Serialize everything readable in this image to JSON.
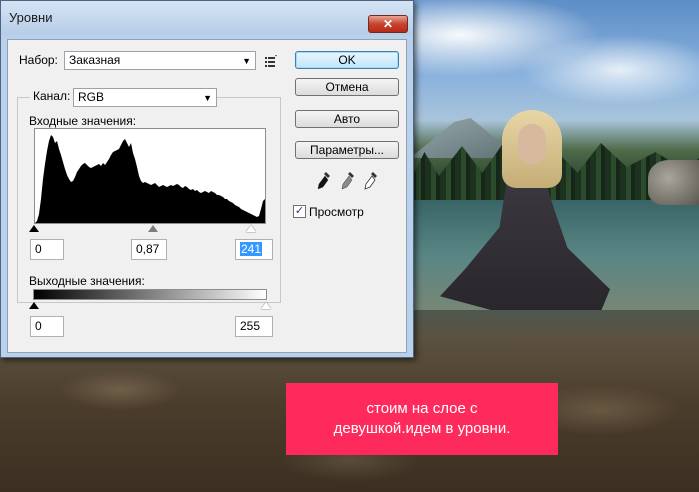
{
  "dialog": {
    "title": "Уровни",
    "close_label": "✕",
    "preset": {
      "label": "Набор:",
      "value": "Заказная"
    },
    "channel": {
      "label": "Канал:",
      "value": "RGB"
    },
    "input_levels": {
      "label": "Входные значения:",
      "black": "0",
      "gamma": "0,87",
      "white": "241"
    },
    "output_levels": {
      "label": "Выходные значения:",
      "black": "0",
      "white": "255"
    },
    "buttons": {
      "ok": "OK",
      "cancel": "Отмена",
      "auto": "Авто",
      "options": "Параметры..."
    },
    "preview": {
      "label": "Просмотр",
      "checked": true
    }
  },
  "caption": {
    "line1": "стоим на слое с",
    "line2": "девушкой.идем в уровни."
  },
  "colors": {
    "caption_bg": "#ff2a5c",
    "selection": "#3399ff"
  }
}
